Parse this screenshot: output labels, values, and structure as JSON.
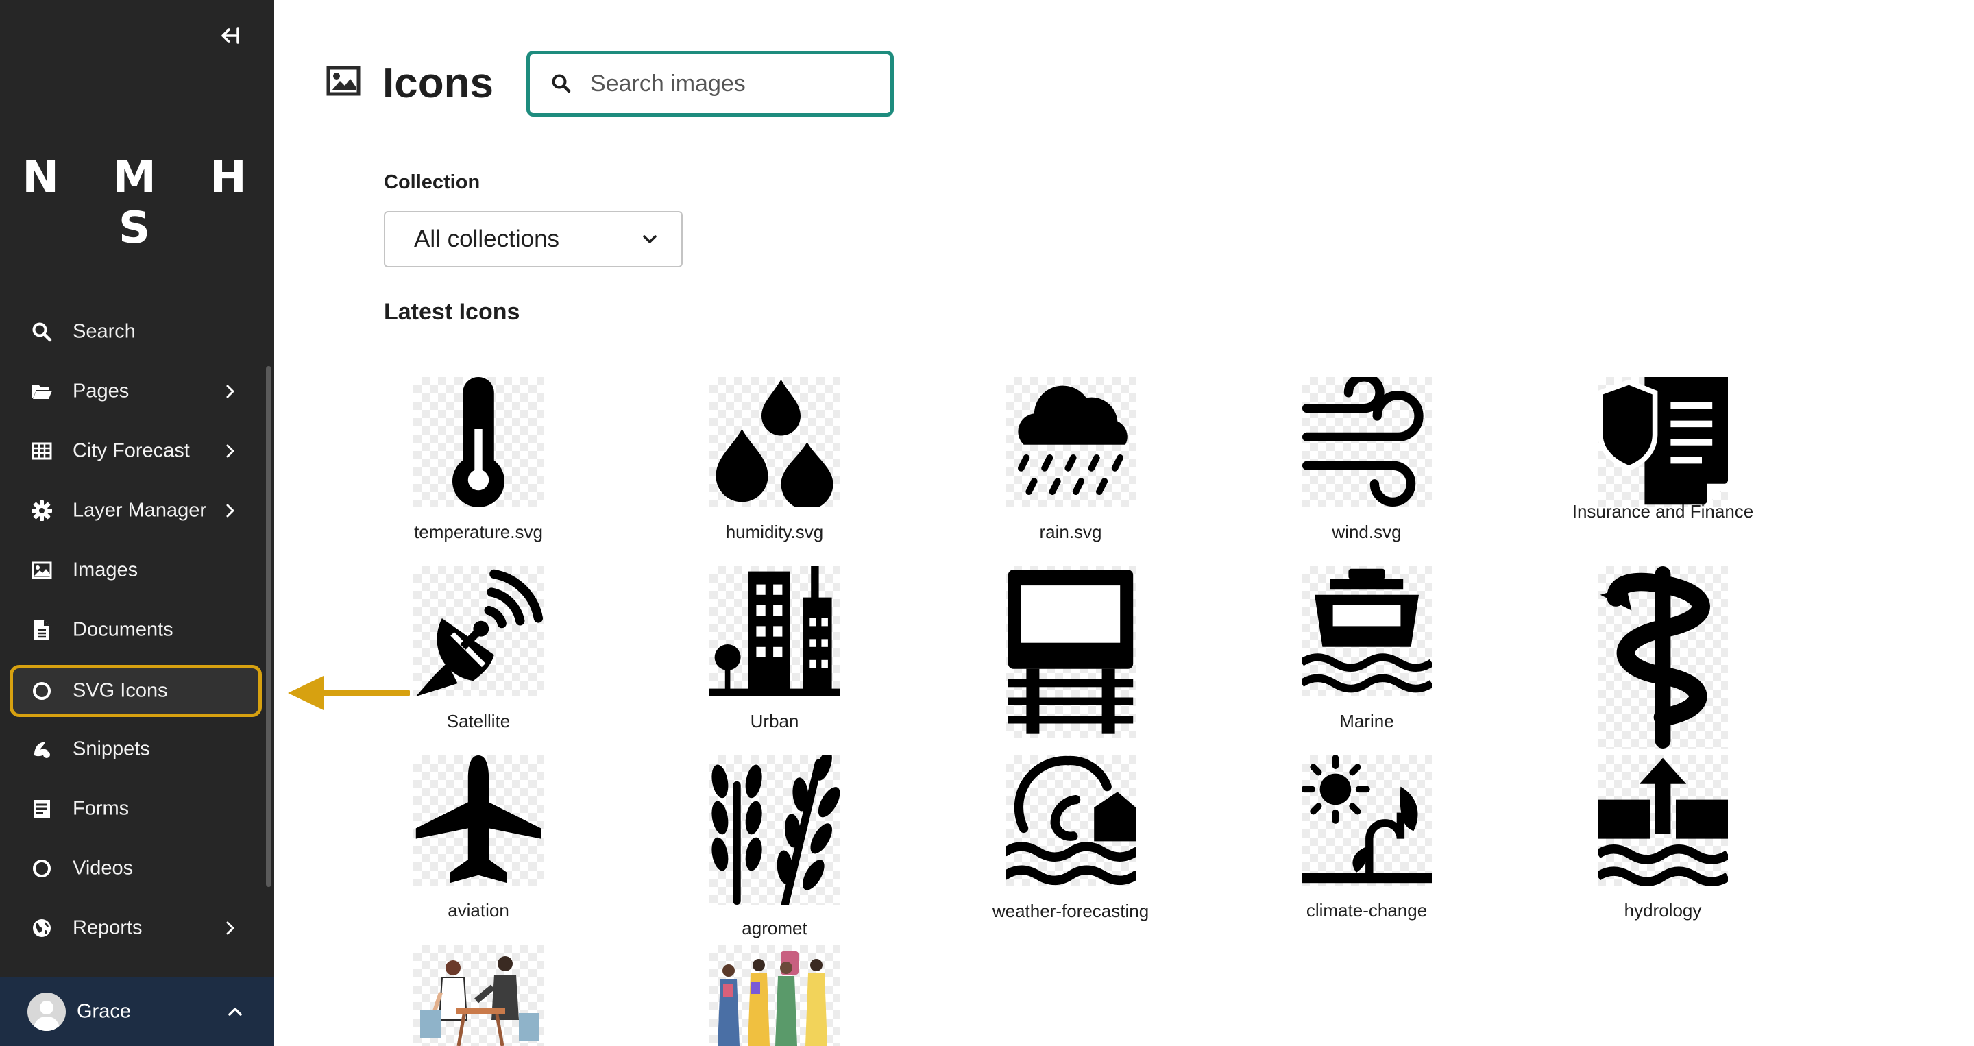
{
  "sidebar": {
    "brand": "N M H S",
    "items": [
      {
        "label": "Search",
        "icon": "search-icon",
        "has_chevron": false
      },
      {
        "label": "Pages",
        "icon": "folder-open-icon",
        "has_chevron": true
      },
      {
        "label": "City Forecast",
        "icon": "table-icon",
        "has_chevron": true
      },
      {
        "label": "Layer Manager",
        "icon": "gear-icon",
        "has_chevron": true
      },
      {
        "label": "Images",
        "icon": "image-icon",
        "has_chevron": false
      },
      {
        "label": "Documents",
        "icon": "document-icon",
        "has_chevron": false
      },
      {
        "label": "SVG Icons",
        "icon": "circle-icon",
        "has_chevron": false,
        "active": true
      },
      {
        "label": "Snippets",
        "icon": "snippet-icon",
        "has_chevron": false
      },
      {
        "label": "Forms",
        "icon": "form-icon",
        "has_chevron": false
      },
      {
        "label": "Videos",
        "icon": "circle-icon",
        "has_chevron": false
      },
      {
        "label": "Reports",
        "icon": "globe-icon",
        "has_chevron": true
      }
    ],
    "user": {
      "name": "Grace"
    }
  },
  "header": {
    "title": "Icons",
    "search_placeholder": "Search images"
  },
  "filters": {
    "collection_label": "Collection",
    "collection_value": "All collections"
  },
  "section_title": "Latest Icons",
  "icons": [
    {
      "label": "temperature.svg",
      "icon": "thermometer-icon"
    },
    {
      "label": "humidity.svg",
      "icon": "droplets-icon"
    },
    {
      "label": "rain.svg",
      "icon": "rain-cloud-icon"
    },
    {
      "label": "wind.svg",
      "icon": "wind-icon"
    },
    {
      "label": "Insurance and Finance",
      "icon": "shield-document-icon"
    },
    {
      "label": "Satellite",
      "icon": "satellite-dish-icon"
    },
    {
      "label": "Urban",
      "icon": "city-icon"
    },
    {
      "label": "",
      "icon": "train-icon"
    },
    {
      "label": "Marine",
      "icon": "ship-icon"
    },
    {
      "label": "",
      "icon": "caduceus-icon"
    },
    {
      "label": "aviation",
      "icon": "airplane-icon"
    },
    {
      "label": "agromet",
      "icon": "wheat-icon"
    },
    {
      "label": "weather-forecasting",
      "icon": "wave-house-icon"
    },
    {
      "label": "climate-change",
      "icon": "sun-plant-icon"
    },
    {
      "label": "hydrology",
      "icon": "water-level-icon"
    },
    {
      "label": "",
      "icon": "meeting-illustration"
    },
    {
      "label": "",
      "icon": "team-illustration"
    }
  ],
  "colors": {
    "sidebar_bg": "#262626",
    "user_bar_bg": "#1d2d44",
    "active_outline": "#d7a110",
    "search_border": "#1e8c7e"
  }
}
